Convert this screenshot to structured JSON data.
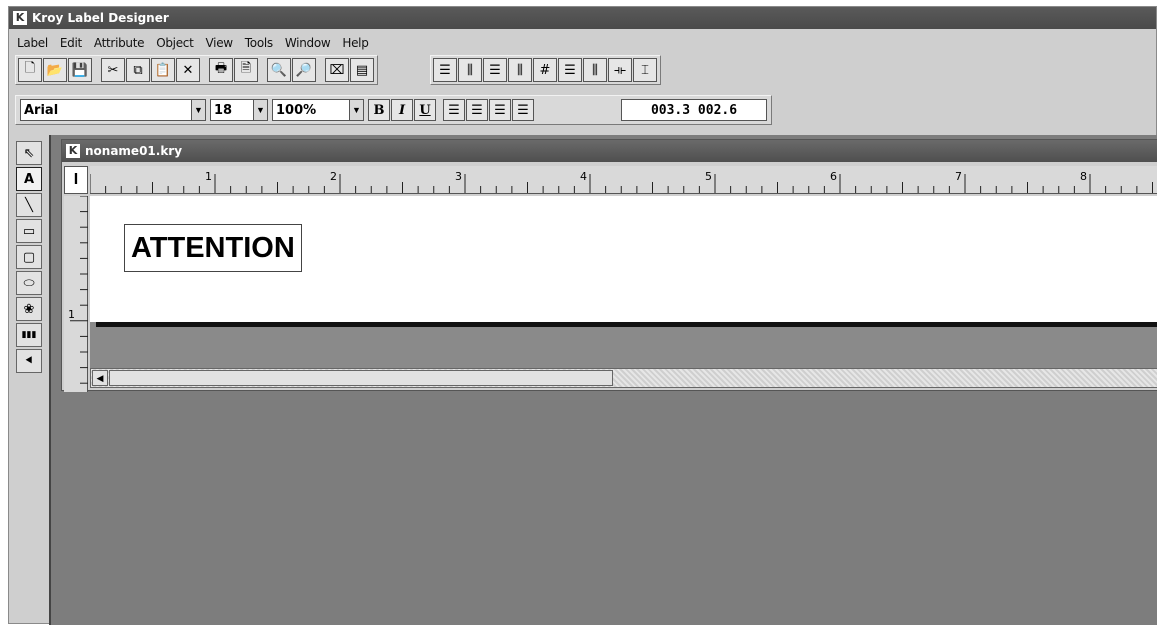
{
  "app": {
    "title": "Kroy Label Designer",
    "icon_letter": "K"
  },
  "menu": [
    "Label",
    "Edit",
    "Attribute",
    "Object",
    "View",
    "Tools",
    "Window",
    "Help"
  ],
  "toolbar": {
    "file_buttons": [
      {
        "name": "new-icon",
        "glyph": "🗋"
      },
      {
        "name": "open-icon",
        "glyph": "📂"
      },
      {
        "name": "save-icon",
        "glyph": "💾"
      }
    ],
    "edit_buttons": [
      {
        "name": "cut-icon",
        "glyph": "✂"
      },
      {
        "name": "copy-icon",
        "glyph": "⧉"
      },
      {
        "name": "paste-icon",
        "glyph": "📋"
      },
      {
        "name": "delete-icon",
        "glyph": "✕"
      }
    ],
    "print_buttons": [
      {
        "name": "print-icon",
        "glyph": "🖶"
      },
      {
        "name": "print-preview-icon",
        "glyph": "🗎"
      }
    ],
    "zoom_buttons": [
      {
        "name": "zoom-in-icon",
        "glyph": "🔍"
      },
      {
        "name": "zoom-out-icon",
        "glyph": "🔎"
      }
    ],
    "misc_buttons": [
      {
        "name": "label-setup-icon",
        "glyph": "⌧"
      },
      {
        "name": "clipboard-icon",
        "glyph": "▤"
      }
    ],
    "align_buttons": [
      {
        "name": "align-left-icon",
        "glyph": "☰"
      },
      {
        "name": "align-center-v-icon",
        "glyph": "⫼"
      },
      {
        "name": "align-right-icon",
        "glyph": "☰"
      },
      {
        "name": "align-top-icon",
        "glyph": "⫼"
      },
      {
        "name": "align-grid-icon",
        "glyph": "#"
      },
      {
        "name": "align-middle-icon",
        "glyph": "☰"
      },
      {
        "name": "align-bottom-icon",
        "glyph": "⫼"
      },
      {
        "name": "space-horizontal-icon",
        "glyph": "⟛"
      },
      {
        "name": "space-vertical-icon",
        "glyph": "⌶"
      }
    ]
  },
  "format": {
    "font": "Arial",
    "size": "18",
    "zoom": "100%",
    "bold": "B",
    "italic": "I",
    "underline": "U",
    "coords": "003.3 002.6"
  },
  "tools": [
    {
      "name": "pointer-tool-icon",
      "glyph": "⇖",
      "active": false
    },
    {
      "name": "text-tool-icon",
      "glyph": "A",
      "active": true
    },
    {
      "name": "line-tool-icon",
      "glyph": "╲",
      "active": false
    },
    {
      "name": "rectangle-tool-icon",
      "glyph": "▭",
      "active": false
    },
    {
      "name": "rounded-rectangle-tool-icon",
      "glyph": "▢",
      "active": false
    },
    {
      "name": "ellipse-tool-icon",
      "glyph": "⬭",
      "active": false
    },
    {
      "name": "image-tool-icon",
      "glyph": "❀",
      "active": false
    },
    {
      "name": "barcode-tool-icon",
      "glyph": "▮▮▮",
      "active": false
    },
    {
      "name": "serial-tool-icon",
      "glyph": "⯇",
      "active": false
    }
  ],
  "document": {
    "title": "noname01.kry",
    "corner_glyph": "I",
    "ruler_numbers": [
      "1",
      "2",
      "3",
      "4",
      "5",
      "6",
      "7",
      "8"
    ],
    "v_ruler_numbers": [
      "1"
    ],
    "text_object": "ATTENTION"
  }
}
